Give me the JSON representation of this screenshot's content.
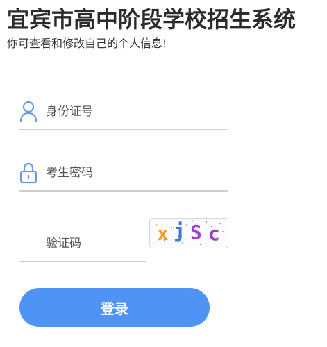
{
  "header": {
    "title": "宜宾市高中阶段学校招生系统",
    "subtitle": "你可查看和修改自己的个人信息!"
  },
  "form": {
    "id_field": {
      "placeholder": "身份证号",
      "value": "",
      "icon": "user-icon"
    },
    "password_field": {
      "placeholder": "考生密码",
      "value": "",
      "icon": "lock-icon"
    },
    "captcha_field": {
      "placeholder": "验证码",
      "value": ""
    },
    "captcha_image": {
      "chars": [
        "x",
        "j",
        "S",
        "c"
      ],
      "colors": [
        "#f0a030",
        "#3a7ad8",
        "#a040d0",
        "#9a3cc8"
      ]
    },
    "login_label": "登录"
  },
  "colors": {
    "accent": "#4f93f5",
    "icon": "#6a9bdf",
    "underline": "#cfcfcf"
  }
}
